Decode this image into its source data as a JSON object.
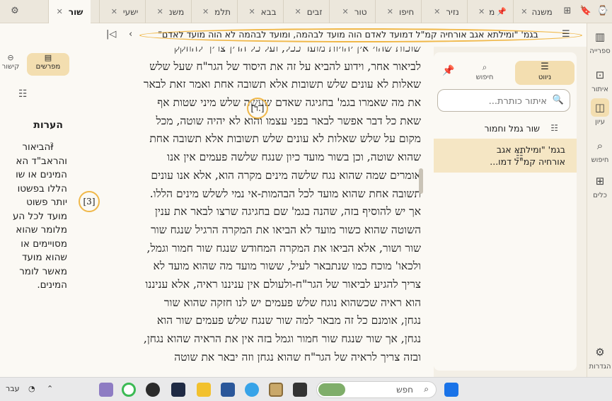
{
  "tabs": [
    {
      "label": "שור",
      "active": true
    },
    {
      "label": "ישעי"
    },
    {
      "label": "משנ"
    },
    {
      "label": "תלמ"
    },
    {
      "label": "בבא"
    },
    {
      "label": "זבים"
    },
    {
      "label": "טור"
    },
    {
      "label": "חיפו"
    },
    {
      "label": "נזיר"
    },
    {
      "label": "מ"
    },
    {
      "label": "משנה"
    }
  ],
  "breadcrumb": "בגמ' \"ומילתא אגב אורחיה קמ\"ל דמועד לאדם הוה מועד לבהמה, ומועד לבהמה לא הוה מועד לאדם\"",
  "rail": [
    {
      "label": "ספרייה",
      "icon": "library-icon"
    },
    {
      "label": "איתור",
      "icon": "find-icon"
    },
    {
      "label": "עיון",
      "icon": "book-open-icon",
      "active": true
    },
    {
      "label": "חיפוש",
      "icon": "search-icon"
    },
    {
      "label": "כלים",
      "icon": "tools-icon"
    },
    {
      "label": "הגדרות",
      "icon": "gear-icon"
    }
  ],
  "notes": {
    "tab_commentators": "מפרשים",
    "tab_links": "קישור",
    "title": "הערות",
    "number": "3",
    "lines": [
      "והביאור",
      "והראב\"ד הא",
      "המינים או שו",
      "הללו בפשטו",
      "יותר פשוט",
      "מועד לכל הע",
      "מלומר שהוא",
      "מסויימים או",
      "שהוא מועד",
      "מאשר לומר",
      "המינים."
    ]
  },
  "main_text": {
    "lines": [
      "שוכות שהוי אין יהויות מועד ככל, ועל כל הדין צריך להוזקק",
      "לביאור אחר, וידוע להביא על זה את היסוד של הגר\"ח שעל שלש",
      "שאלות לא עונים שלש תשובות אלא תשובה אחת ואמר זאת לבאר",
      "את מה שאמרו בגמ' בחגיגה שאדם שעשה שלש מיני שטות אף",
      "שאת כל דבר אפשר לבאר בפני עצמו והוא לא יהיה שוטה, מכל",
      "מקום על שלש שאלות לא עונים שלש תשובות אלא תשובה אחת",
      "שהוא שוטה, וכן בשור מועד כיון שנגח שלשה פעמים אין אנו",
      "אומרים שמה שהוא נגח שלשה מינים מקרה הוא, אלא אנו עונים",
      "תשובה אחת שהוא מועד לכל הבהמות-אי נמי לשלש מינים הללו.",
      "אך יש להוסיף בזה, שהנה בגמ' שם בחגיגה שרצו לבאר את ענין",
      "השוטה שהוא כשור מועד לא הביאו את המקרה הרגיל שנגח שור",
      "שור ושור, אלא הביאו את המקרה המחודש שנגח שור חמור וגמל,",
      "ולכאו' מוכח כמו שנתבאר לעיל, ששור מועד מה שהוא מועד לא",
      "צריך להגיע לביאור של הגר\"ח-ולעולם אין עניננו ראיה, אלא עניננו",
      "הוא ראיה שכשהוא נוגח שלש פעמים יש לנו חזקה שהוא שור",
      "נגחן, אומנם כל זה מבאר למה שור שנגח שלש פעמים שור הוא",
      "נגחן, אך שור שנגח שור חמור וגמל בזה אין את הראיה שהוא נגחן,",
      "ובזה צריך לראיה של הגר\"ח שהוא נגחן וזה יבאר את שוטה"
    ],
    "marker1": "[ד.]",
    "marker2": "[3]"
  },
  "toc": {
    "tab_nav": "ניווט",
    "tab_search": "חיפוש",
    "search_placeholder": "איתור כותרת...",
    "item1": "שור גמל וחמור",
    "item2_line1": "בגמ' \"ומילתא אגב",
    "item2_line2": "אורחיה קמ\"ל דמו..."
  },
  "taskbar": {
    "search_placeholder": "חפש",
    "tray_lang": "עבר"
  },
  "colors": {
    "accent": "#f3deb0",
    "highlight": "#f0b84a",
    "panel": "#fbf9f4"
  }
}
